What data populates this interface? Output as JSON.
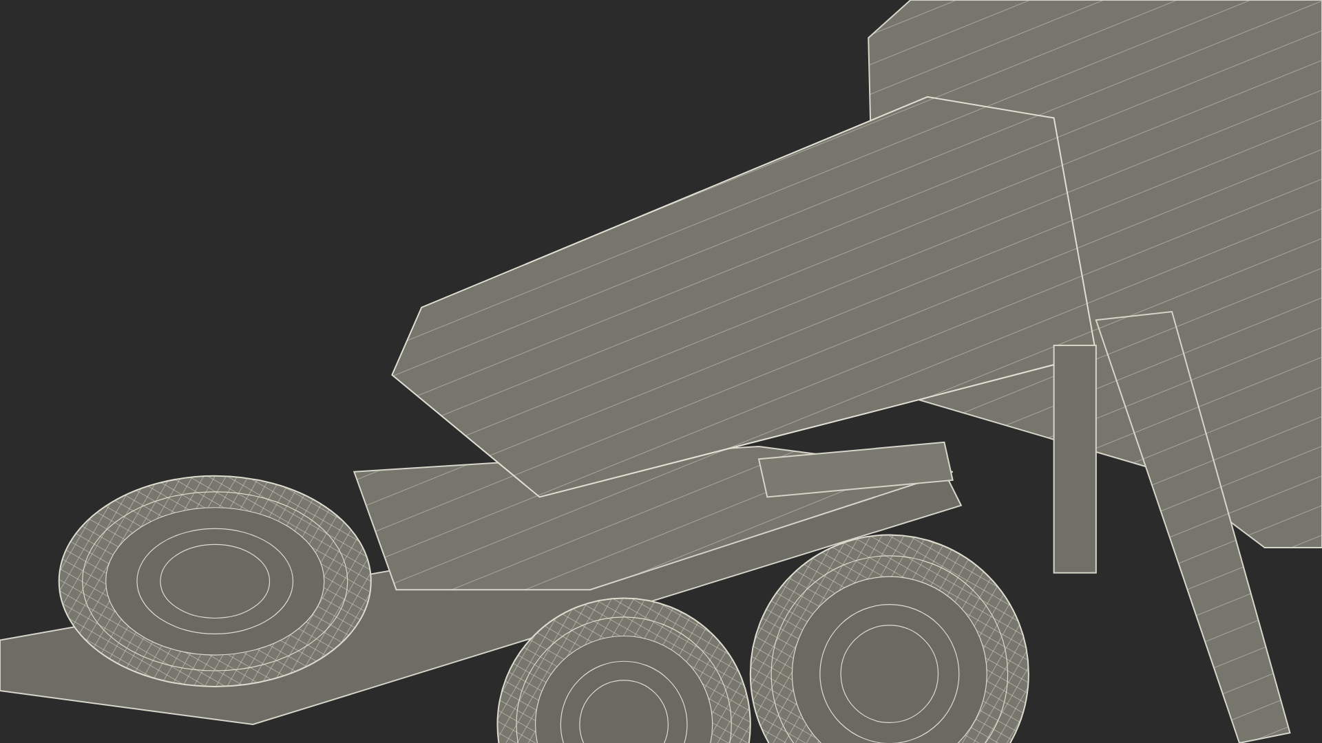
{
  "viewport": {
    "kind": "wireframe-render"
  }
}
